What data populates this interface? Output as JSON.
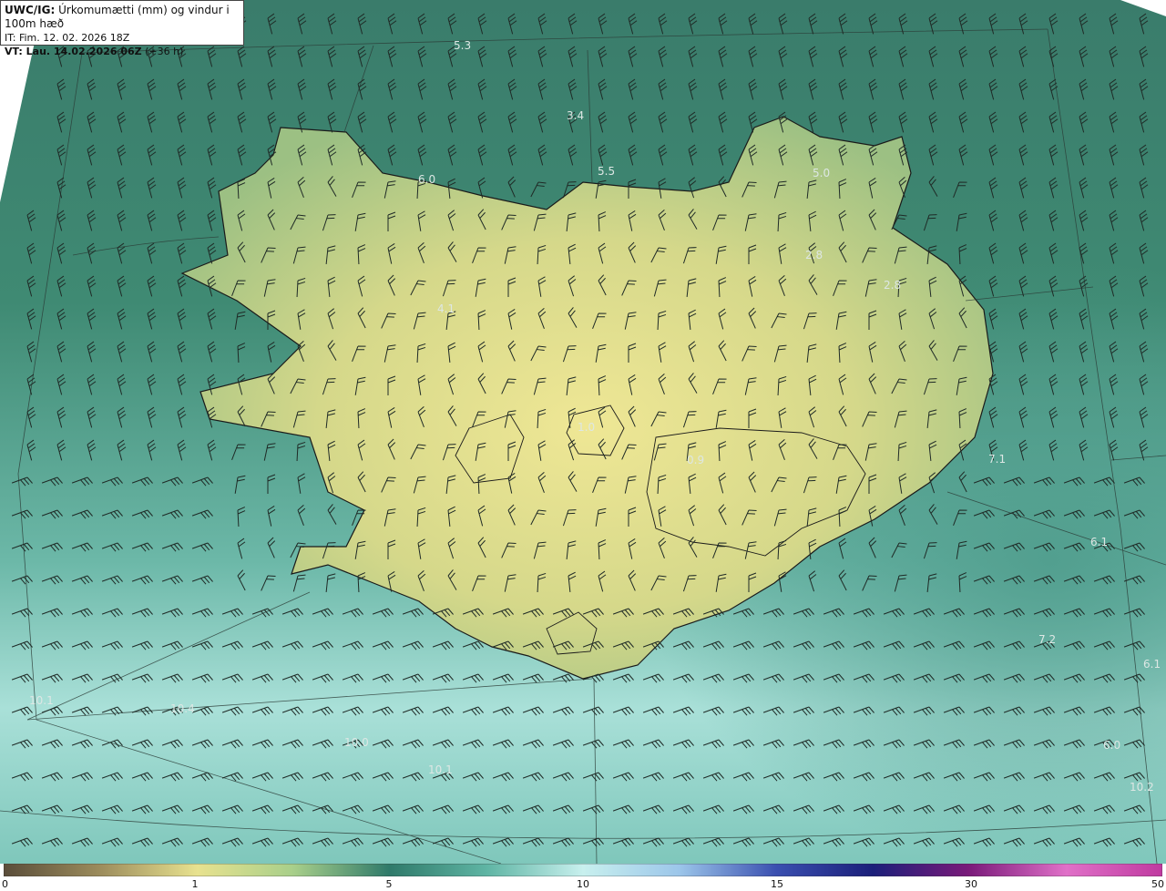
{
  "header": {
    "model": "UWC/IG:",
    "title": "Úrkomumætti (mm) og vindur i 100m hæð",
    "it_label": "IT: Fim. 12. 02. 2026 18Z",
    "vt_label": "VT: Lau. 14.02.2026 06Z",
    "lead_label": "(+36 h)"
  },
  "map": {
    "labels": [
      "5.3",
      "3.4",
      "5.5",
      "6.0",
      "5.0",
      "2.8",
      "2.8",
      "4.1",
      "1.0",
      "0.9",
      "7.1",
      "6.1",
      "7.2",
      "6.1",
      "6.0",
      "10.4",
      "10.0",
      "10.1",
      "10.1",
      "10.2"
    ]
  },
  "colorbar": {
    "ticks": [
      "0",
      "1",
      "5",
      "10",
      "15",
      "30",
      "50"
    ],
    "colors": [
      "#5a4d3a",
      "#9c8c5c",
      "#e8e28f",
      "#a8cf8a",
      "#2f7a6a",
      "#5fb5a4",
      "#c8f0ee",
      "#9cc6ea",
      "#3a4fb0",
      "#1b1f7a",
      "#7a1a7a",
      "#e070c8",
      "#c03aa0"
    ]
  },
  "colors": {
    "land_high": "#f2ea96",
    "land_low": "#7fae7a",
    "sea_north": "#3f8470",
    "sea_south": "#9fd9d2",
    "coastline": "#1a1a1a"
  }
}
